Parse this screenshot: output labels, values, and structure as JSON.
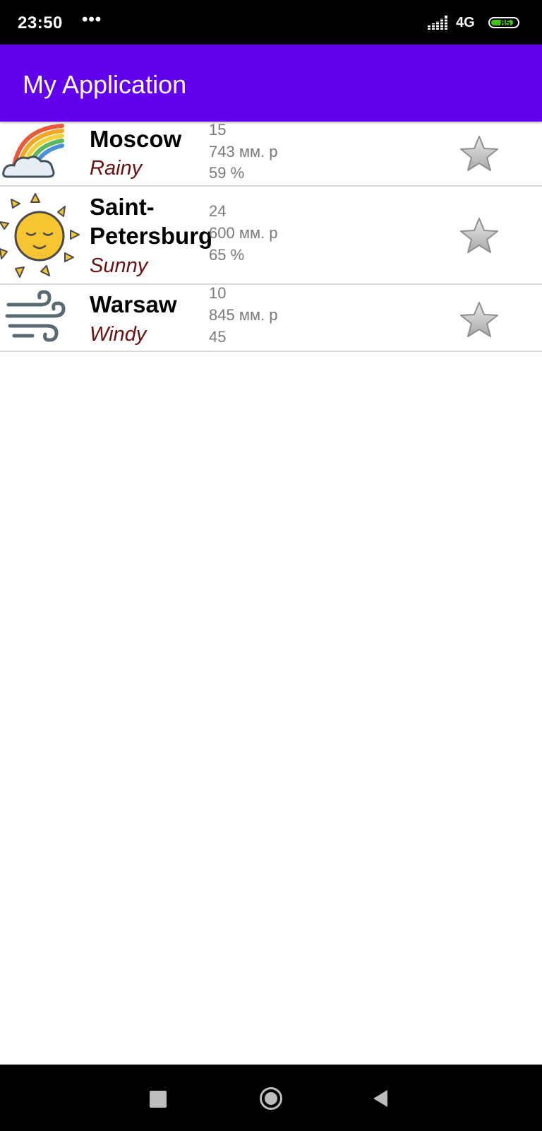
{
  "status_bar": {
    "time": "23:50",
    "dots": "•••",
    "network": "4G",
    "battery": "85",
    "battery_level": 0.85,
    "icons": [
      "signal-icon",
      "battery-icon"
    ]
  },
  "app_bar": {
    "title": "My Application",
    "color": "#6200ee"
  },
  "cities": [
    {
      "name": "Moscow",
      "condition": "Rainy",
      "temperature": "15",
      "pressure": "743 мм. р",
      "humidity": "59 %",
      "icon": "rainbow-cloud-icon"
    },
    {
      "name": "Saint-Petersburg",
      "condition": "Sunny",
      "temperature": "24",
      "pressure": "600 мм. р",
      "humidity": "65 %",
      "icon": "sun-icon"
    },
    {
      "name": "Warsaw",
      "condition": "Windy",
      "temperature": "10",
      "pressure": "845 мм. р",
      "humidity": "45",
      "icon": "wind-icon"
    }
  ],
  "nav_bar": {
    "icons": [
      "recents-icon",
      "home-icon",
      "back-icon"
    ]
  },
  "colors": {
    "condition_text": "#6b1010",
    "metric_text": "#7a7a7a",
    "star": "#b8b8b8"
  }
}
